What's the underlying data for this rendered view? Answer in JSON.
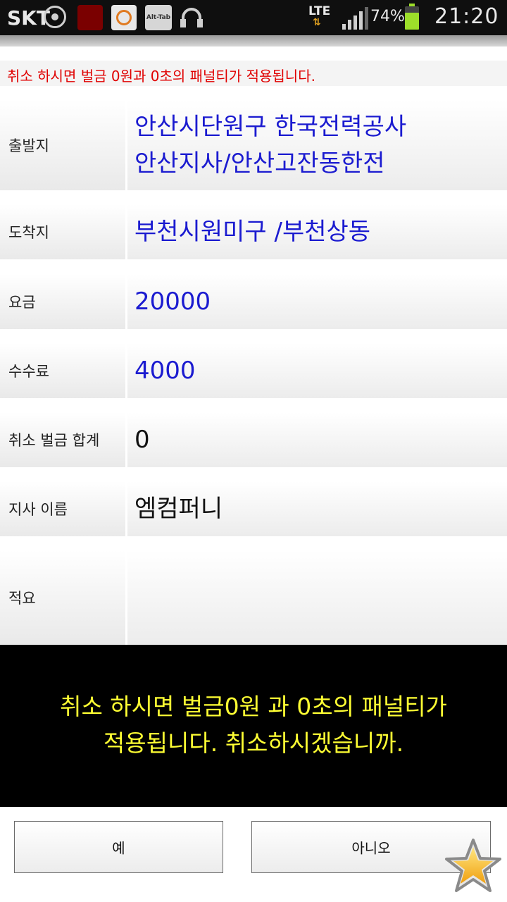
{
  "statusbar": {
    "carrier": "SKT",
    "call_app_label": "CALL\nMANER",
    "alttab_label": "Alt-Tab",
    "network": "LTE",
    "battery_text": "74%",
    "battery_level": 0.74,
    "time": "21:20",
    "colors": {
      "battery": "#9dde2a",
      "bar": "#0f0f0f"
    }
  },
  "notice": "취소 하시면 벌금 0원과 0초의 패널티가 적용됩니다.",
  "fields": {
    "departure": {
      "label": "출발지",
      "lines": [
        "안산시단원구 한국전력공사",
        "안산지사/안산고잔동한전"
      ]
    },
    "destination": {
      "label": "도착지",
      "value": "부천시원미구 /부천상동"
    },
    "fare": {
      "label": "요금",
      "value": "20000"
    },
    "fee": {
      "label": "수수료",
      "value": "4000"
    },
    "penalty_total": {
      "label": "취소 벌금 합계",
      "value": "0"
    },
    "branch_name": {
      "label": "지사 이름",
      "value": "엠컴퍼니"
    },
    "memo": {
      "label": "적요",
      "value": ""
    }
  },
  "dialog": {
    "line1": "취소 하시면 벌금0원 과 0초의 패널티가",
    "line2": "적용됩니다. 취소하시겠습니까.",
    "colors": {
      "text": "#ffff33",
      "background": "#000000"
    }
  },
  "buttons": {
    "yes": "예",
    "no": "아니오"
  },
  "overlay_icon": "star-icon"
}
